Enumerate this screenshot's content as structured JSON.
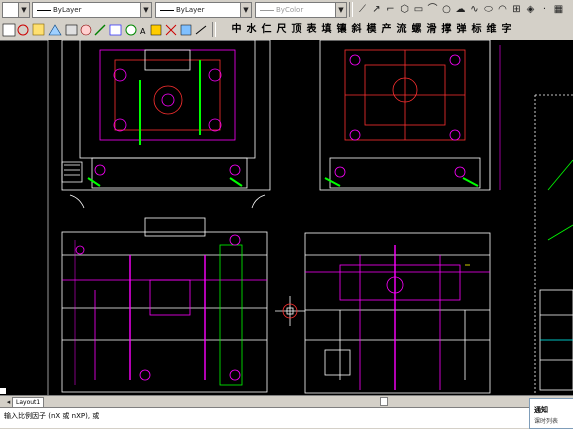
{
  "toolbar": {
    "layer_combo": "ByLayer",
    "linetype_combo": "ByLayer",
    "lineweight_combo": "ByLayer",
    "color_combo": "ByColor"
  },
  "mold_toolbar": {
    "labels": [
      "中",
      "水",
      "仁",
      "尺",
      "顶",
      "表",
      "填",
      "镶",
      "斜",
      "模",
      "产",
      "流",
      "螺",
      "滑",
      "撑",
      "弹",
      "标",
      "维",
      "字"
    ]
  },
  "tabs": {
    "layout": "Layout1"
  },
  "command": {
    "prompt": "输入比例因子 (nX 或 nXP), 或"
  },
  "popup": {
    "title": "通知",
    "subtitle": "课时列表"
  },
  "colors": {
    "canvas": "#000000",
    "line_white": "#ffffff",
    "line_magenta": "#ff00ff",
    "line_red": "#ff3030",
    "line_green": "#00ff00",
    "line_yellow": "#ffff00",
    "line_cyan": "#00ffff"
  }
}
